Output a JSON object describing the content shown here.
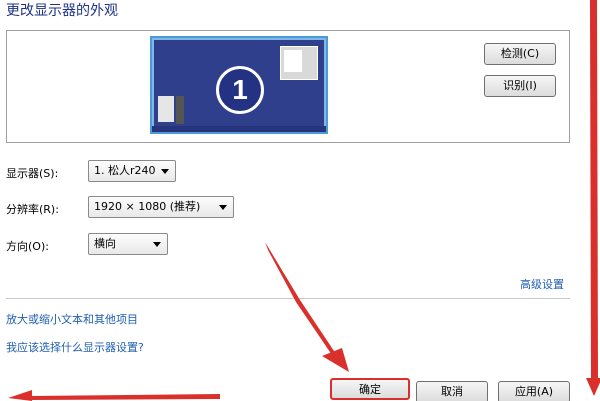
{
  "title": "更改显示器的外观",
  "buttons": {
    "detect": "检测(C)",
    "identify": "识别(I)",
    "ok": "确定",
    "cancel": "取消",
    "apply": "应用(A)"
  },
  "monitor_preview": {
    "number": "1"
  },
  "fields": {
    "display": {
      "label": "显示器(S):",
      "value": "1. 松人r240"
    },
    "resolution": {
      "label": "分辨率(R):",
      "value": "1920 × 1080 (推荐)"
    },
    "orientation": {
      "label": "方向(O):",
      "value": "横向"
    }
  },
  "links": {
    "advanced": "高级设置",
    "enlarge_text": "放大或缩小文本和其他项目",
    "which_settings": "我应该选择什么显示器设置?"
  },
  "colors": {
    "title": "#1e3287",
    "link": "#1f5fb1",
    "annotation_red": "#d9302c",
    "monitor_blue": "#2f3f8c"
  }
}
